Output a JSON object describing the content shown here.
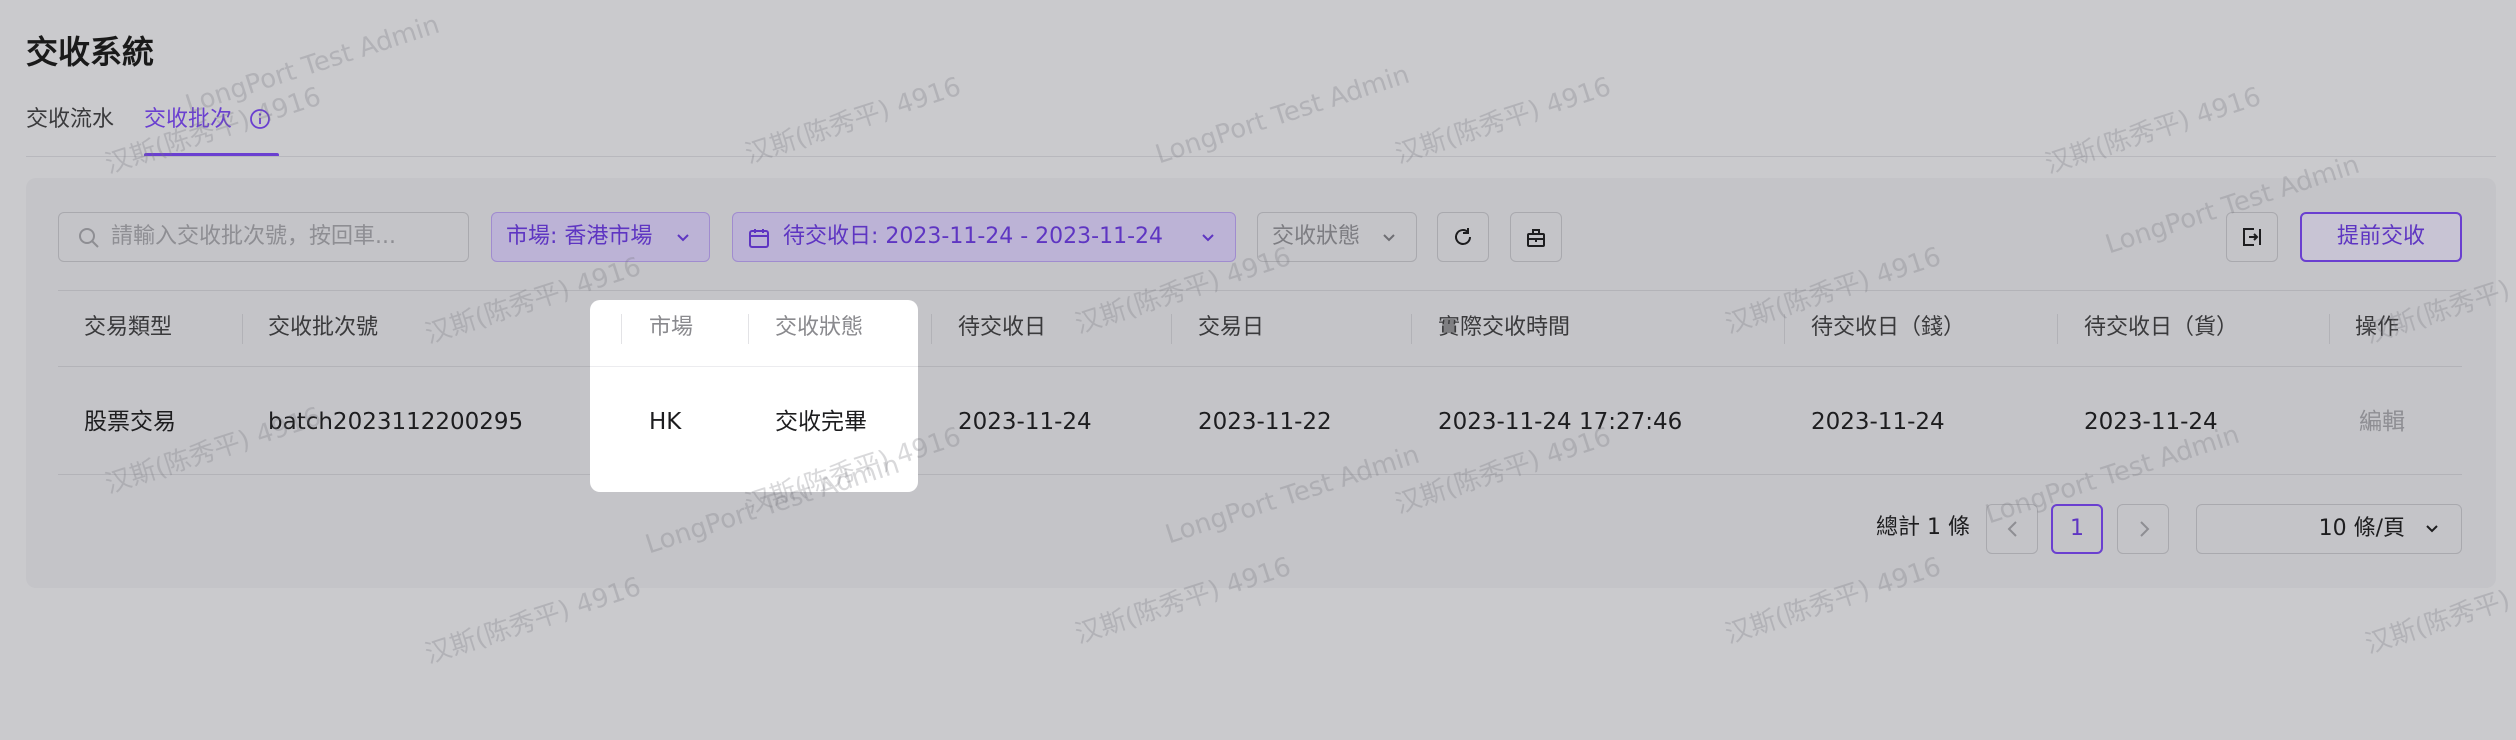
{
  "header": {
    "title": "交收系統"
  },
  "tabs": [
    {
      "label": "交收流水",
      "active": false
    },
    {
      "label": "交收批次",
      "active": true
    }
  ],
  "filters": {
    "search_placeholder": "請輸入交收批次號，按回車...",
    "market": "市場: 香港市場",
    "settlement_date": "待交收日: 2023-11-24 - 2023-11-24",
    "status_placeholder": "交收狀態"
  },
  "actions": {
    "submit_label": "提前交收"
  },
  "table": {
    "columns": [
      "交易類型",
      "交收批次號",
      "市場",
      "交收狀態",
      "待交收日",
      "交易日",
      "實際交收時間",
      "待交收日（錢）",
      "待交收日（貨）",
      "操作"
    ],
    "rows": [
      {
        "trade_type": "股票交易",
        "batch_no": "batch2023112200295",
        "market": "HK",
        "status": "交收完畢",
        "settle_date": "2023-11-24",
        "trade_date": "2023-11-22",
        "actual_time": "2023-11-24 17:27:46",
        "cash_date": "2023-11-24",
        "goods_date": "2023-11-24",
        "action": "編輯"
      }
    ]
  },
  "pagination": {
    "total": "總計 1 條",
    "current": "1",
    "page_size": "10 條/頁"
  },
  "watermark": {
    "line1": "汉斯(陈秀平) 4916",
    "line2": "LongPort Test Admin"
  },
  "colors": {
    "accent": "#6a3fd0",
    "overlay": "#cacacd",
    "highlight": "#ffffff"
  }
}
